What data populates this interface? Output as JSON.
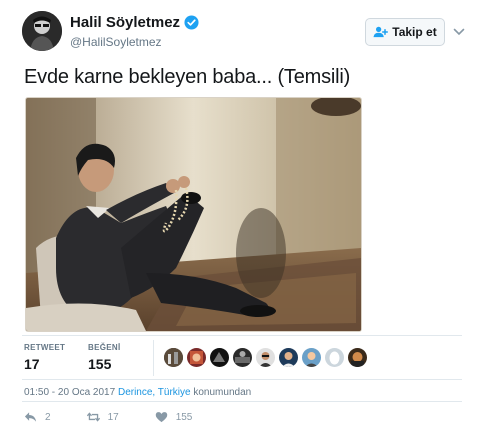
{
  "user": {
    "name": "Halil Söyletmez",
    "handle": "@HalilSoyletmez",
    "verified": true
  },
  "follow_button": {
    "label": "Takip et",
    "icon": "add-user-icon"
  },
  "tweet": {
    "text": "Evde karne bekleyen baba... (Temsili)"
  },
  "stats": {
    "retweets": {
      "label": "RETWEET",
      "value": "17"
    },
    "likes": {
      "label": "BEĞENİ",
      "value": "155"
    }
  },
  "meta": {
    "time": "01:50 - 20 Oca 2017",
    "place": "Derince, Türkiye",
    "place_suffix": "konumundan"
  },
  "actions": {
    "reply_count": "2",
    "retweet_count": "17",
    "like_count": "155"
  },
  "colors": {
    "accent": "#1b95e0",
    "verified": "#1da1f2",
    "muted": "#657786"
  }
}
